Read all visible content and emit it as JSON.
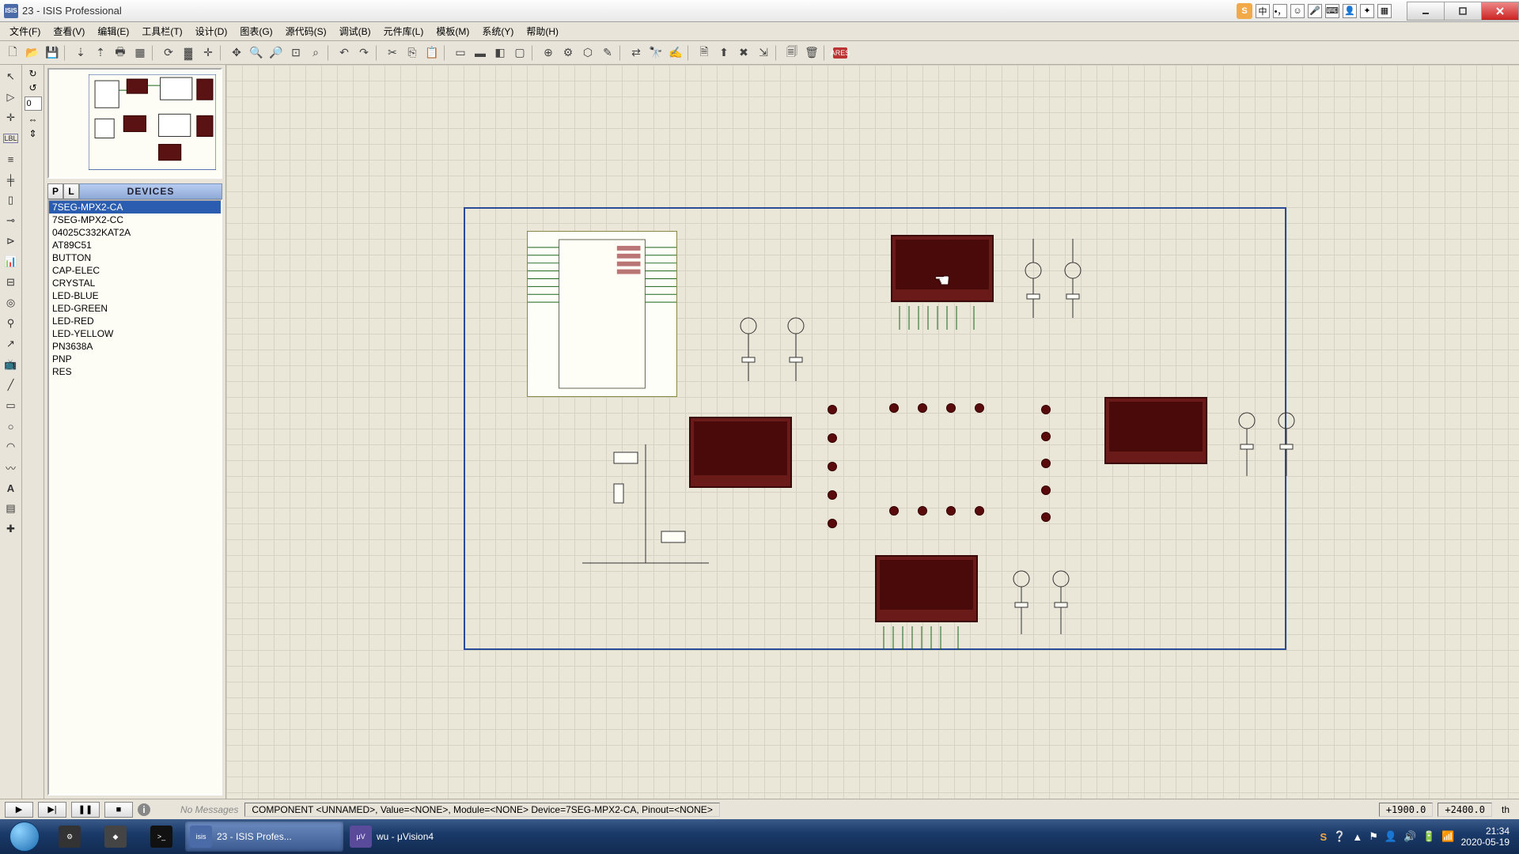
{
  "title": "23 - ISIS Professional",
  "menu": [
    "文件(F)",
    "查看(V)",
    "编辑(E)",
    "工具栏(T)",
    "设计(D)",
    "图表(G)",
    "源代码(S)",
    "调试(B)",
    "元件库(L)",
    "模板(M)",
    "系统(Y)",
    "帮助(H)"
  ],
  "panel": {
    "p_label": "P",
    "l_label": "L",
    "header": "DEVICES",
    "overview_input": "0"
  },
  "devices": [
    "7SEG-MPX2-CA",
    "7SEG-MPX2-CC",
    "04025C332KAT2A",
    "AT89C51",
    "BUTTON",
    "CAP-ELEC",
    "CRYSTAL",
    "LED-BLUE",
    "LED-GREEN",
    "LED-RED",
    "LED-YELLOW",
    "PN3638A",
    "PNP",
    "RES"
  ],
  "selected_device_index": 0,
  "simbar": {
    "no_messages": "No Messages",
    "status": "COMPONENT <UNNAMED>, Value=<NONE>, Module=<NONE>  Device=7SEG-MPX2-CA, Pinout=<NONE>",
    "coord_x": "+1900.0",
    "coord_y": "+2400.0",
    "unit": "th"
  },
  "lang": {
    "ime": "S",
    "mode": "中"
  },
  "taskbar": {
    "items": [
      {
        "label": "23 - ISIS Profes...",
        "icon": "isis",
        "active": true
      },
      {
        "label": "wu  - μVision4",
        "icon": "uv",
        "active": false
      }
    ],
    "time": "21:34",
    "date": "2020-05-19"
  }
}
